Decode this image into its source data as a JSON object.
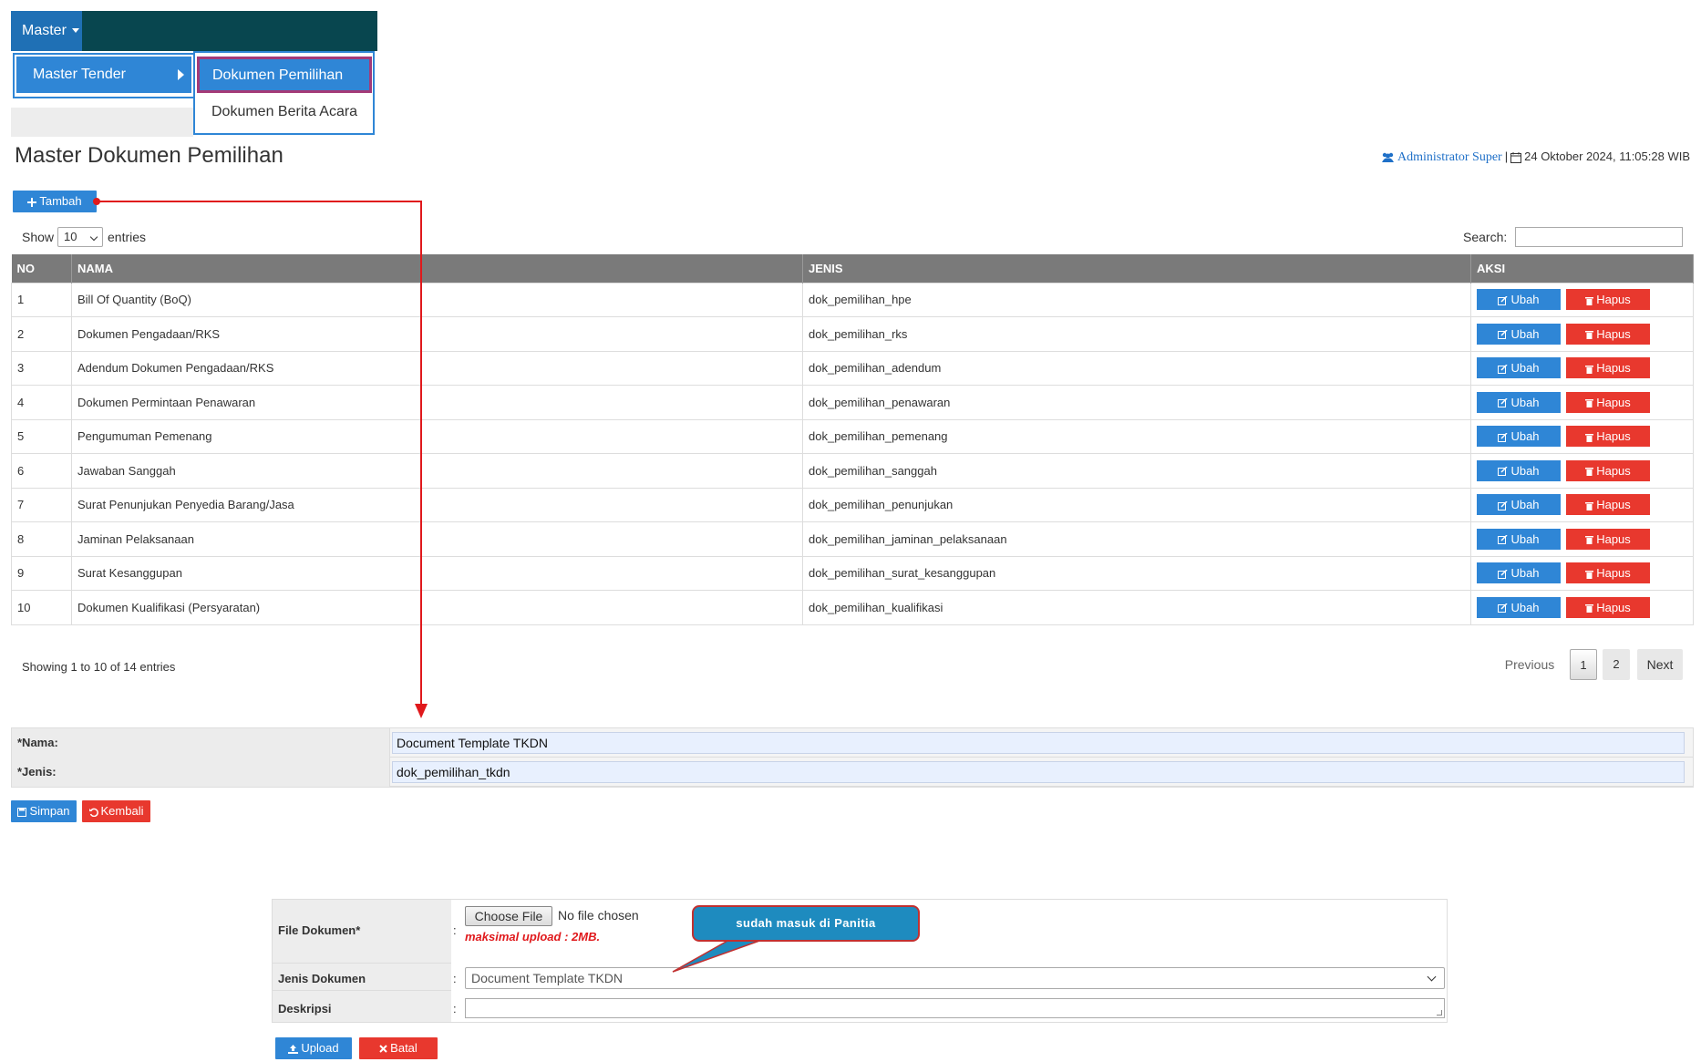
{
  "nav": {
    "master_label": "Master",
    "submenu_label": "Master Tender",
    "submenu2_items": [
      "Dokumen Pemilihan",
      "Dokumen Berita Acara"
    ]
  },
  "page_title": "Master Dokumen Pemilihan",
  "user": {
    "name": "Administrator Super",
    "datetime": "24 Oktober 2024, 11:05:28 WIB"
  },
  "tambah_label": "Tambah",
  "list": {
    "show_label": "Show",
    "show_value": "10",
    "entries_label": "entries",
    "search_label": "Search:"
  },
  "table": {
    "headers": [
      "NO",
      "NAMA",
      "JENIS",
      "AKSI"
    ],
    "rows": [
      {
        "no": "1",
        "nama": "Bill Of Quantity (BoQ)",
        "jenis": "dok_pemilihan_hpe"
      },
      {
        "no": "2",
        "nama": "Dokumen Pengadaan/RKS",
        "jenis": "dok_pemilihan_rks"
      },
      {
        "no": "3",
        "nama": "Adendum Dokumen Pengadaan/RKS",
        "jenis": "dok_pemilihan_adendum"
      },
      {
        "no": "4",
        "nama": "Dokumen Permintaan Penawaran",
        "jenis": "dok_pemilihan_penawaran"
      },
      {
        "no": "5",
        "nama": "Pengumuman Pemenang",
        "jenis": "dok_pemilihan_pemenang"
      },
      {
        "no": "6",
        "nama": "Jawaban Sanggah",
        "jenis": "dok_pemilihan_sanggah"
      },
      {
        "no": "7",
        "nama": "Surat Penunjukan Penyedia Barang/Jasa",
        "jenis": "dok_pemilihan_penunjukan"
      },
      {
        "no": "8",
        "nama": "Jaminan Pelaksanaan",
        "jenis": "dok_pemilihan_jaminan_pelaksanaan"
      },
      {
        "no": "9",
        "nama": "Surat Kesanggupan",
        "jenis": "dok_pemilihan_surat_kesanggupan"
      },
      {
        "no": "10",
        "nama": "Dokumen Kualifikasi (Persyaratan)",
        "jenis": "dok_pemilihan_kualifikasi"
      }
    ],
    "ubah_label": "Ubah",
    "hapus_label": "Hapus"
  },
  "pagination": {
    "showing": "Showing 1 to 10 of 14 entries",
    "previous": "Previous",
    "pages": [
      "1",
      "2"
    ],
    "next": "Next"
  },
  "form": {
    "nama_label": "*Nama:",
    "nama_value": "Document Template TKDN",
    "jenis_label": "*Jenis:",
    "jenis_value": "dok_pemilihan_tkdn",
    "simpan_label": "Simpan",
    "kembali_label": "Kembali"
  },
  "upload_form": {
    "file_label": "File Dokumen*",
    "choose_file": "Choose File",
    "no_file": "No file chosen",
    "max_upload": "maksimal upload : 2MB.",
    "jenis_label": "Jenis Dokumen",
    "jenis_value": "Document Template TKDN",
    "deskripsi_label": "Deskripsi",
    "colon": ":",
    "upload_label": "Upload",
    "batal_label": "Batal"
  },
  "callout": "sudah masuk di Panitia",
  "colors": {
    "primary": "#2f86d6",
    "danger": "#e8382e",
    "nav_bg": "#08464f",
    "annotation": "#e0191c"
  }
}
